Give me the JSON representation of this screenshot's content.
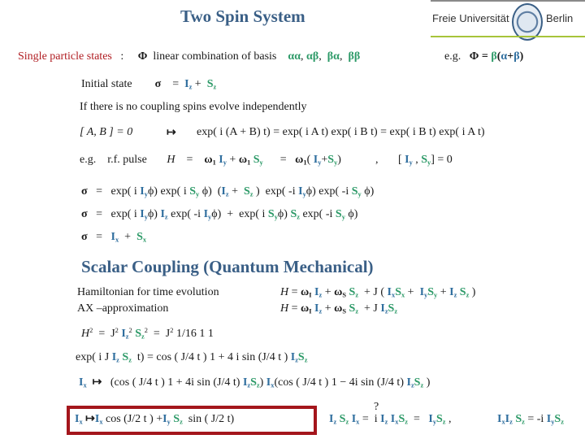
{
  "header": {
    "title": "Two Spin System",
    "logo": {
      "left": "Freie Universität",
      "right": "Berlin",
      "seal_icon": "university-seal-icon"
    }
  },
  "single_particle": {
    "label": "Single particle states",
    "colon": ":",
    "phi": "Φ",
    "text": "linear combination of basis",
    "basis": [
      "αα",
      "αβ",
      "βα",
      "ββ"
    ],
    "eg": "e.g.",
    "example": {
      "lhs": "Φ",
      "eq": "=",
      "beta": "β",
      "open": "(",
      "alpha": "α",
      "plus": "+",
      "beta2": "β",
      "close": ")"
    }
  },
  "initial_state": {
    "label": "Initial state",
    "sigma": "σ",
    "eq": "=",
    "I": "I",
    "Isub": "z",
    "plus": "+",
    "S": "S",
    "Ssub": "z"
  },
  "no_coupling": {
    "text": "If there is no coupling spins evolve independently",
    "commutator": "[ A, B ] = 0",
    "mapsto": "↦",
    "equation": "exp( i (A + B) t) =  exp( i A t) exp( i B t)  =   exp( i B t)  exp( i A t)"
  },
  "rf_pulse": {
    "eg": "e.g.",
    "label": "r.f. pulse",
    "H": "H",
    "eq": "=",
    "omega": "ω",
    "omega_sub": "1",
    "plus": "+",
    "comma": ",",
    "commutator_tail": "] = 0"
  },
  "sigma_lines": [
    "σ  =  exp( i Iyϕ) exp( i Syϕ)  (Iz +  Sz )  exp( -i Iyϕ) exp( -i Syϕ)",
    "σ  =  exp( i Iyϕ) Iz exp( -i Iyϕ)  +  exp( i Syϕ) Sz exp( -i Syϕ)",
    "σ  =  Ix  +  Sx"
  ],
  "scalar": {
    "heading": "Scalar Coupling (Quantum Mechanical)",
    "hamiltonian_label": "Hamiltonian  for  time evolution",
    "ax_label": "AX –approximation",
    "H": "H",
    "eq": "=",
    "omega_I": "I",
    "omega_S": "S",
    "J": "J"
  },
  "derivation": {
    "h2_tail": "1/16  1  1",
    "exp_line_mid": "t) =  cos ( J/4 t ) 1     +   4 i  sin (J/4 t )",
    "ix_line_a": "(cos ( J/4 t ) 1 + 4i sin (J/4 t)",
    "ix_line_b": "(cos ( J/4 t ) 1 − 4i sin (J/4 t)",
    "boxed": "cos (J/2 t )  +",
    "boxed_tail": "sin ( J/2  t)",
    "question": "?",
    "identity_eq": "=",
    "identity_i": "i",
    "identity2": "= -i"
  },
  "colors": {
    "blue": "#2f6e9e",
    "green": "#2d9a68",
    "red": "#b01d22",
    "title": "#3a5f86",
    "box": "#a4161c"
  }
}
